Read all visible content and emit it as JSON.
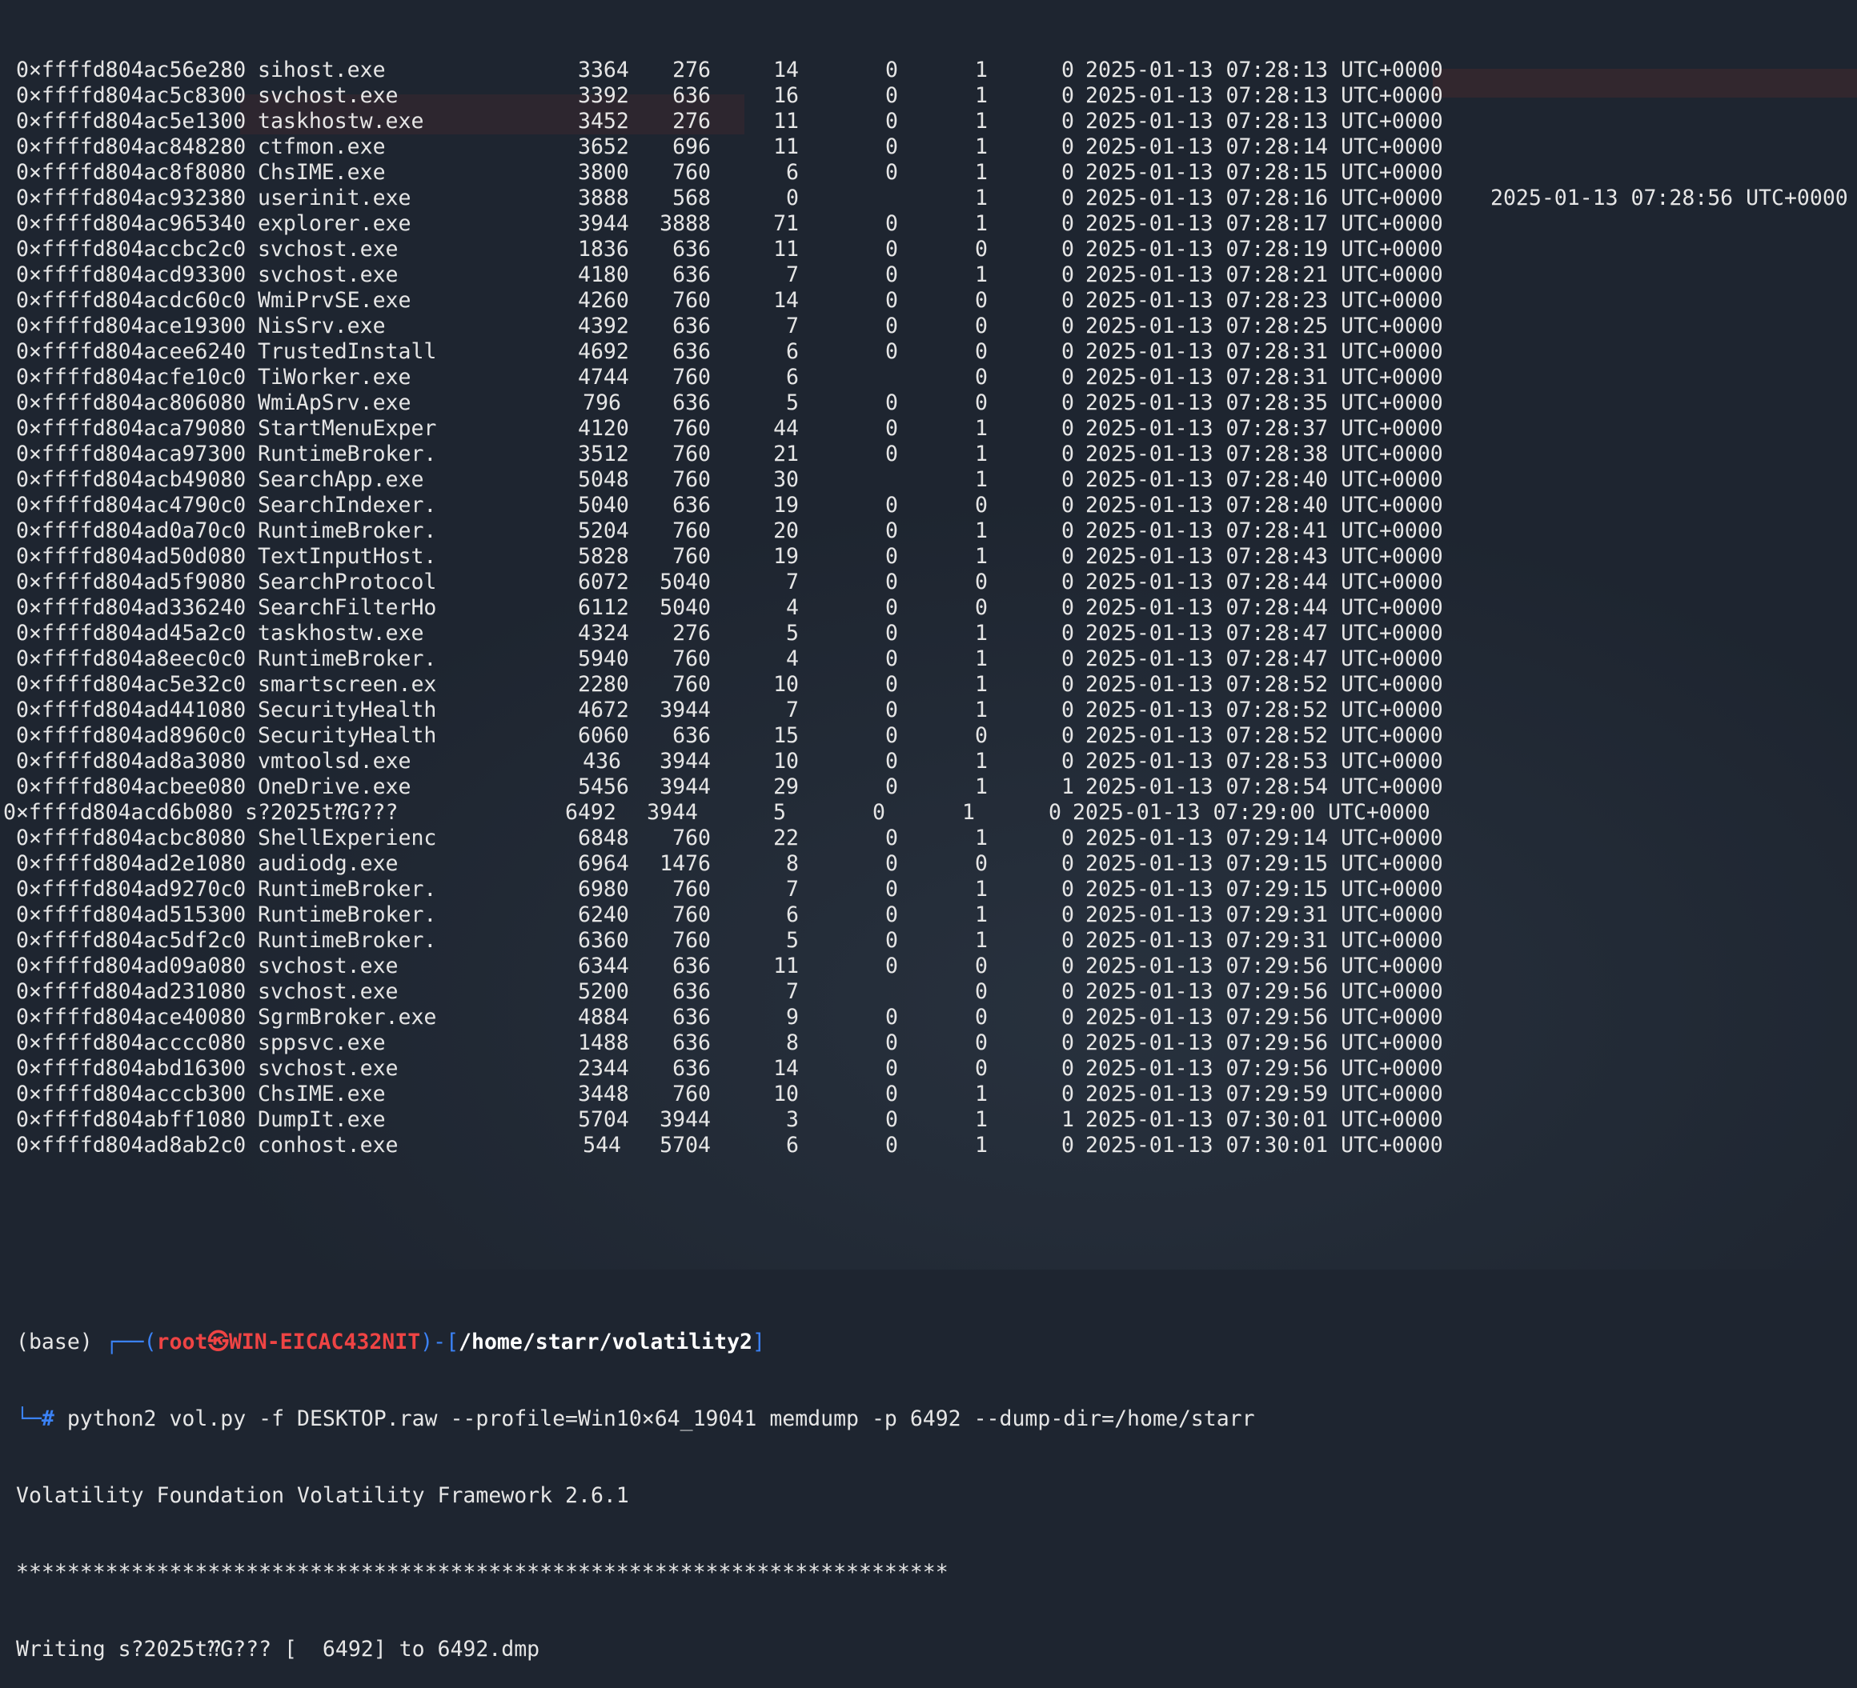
{
  "processes": [
    {
      "offset": "0×ffffd804ac56e280",
      "name": "sihost.exe",
      "pid": "3364",
      "ppid": "276",
      "thds": "14",
      "hnds": "0",
      "sess": "1",
      "wow64": "0",
      "start": "2025-01-13 07:28:13 UTC+0000",
      "exit": ""
    },
    {
      "offset": "0×ffffd804ac5c8300",
      "name": "svchost.exe",
      "pid": "3392",
      "ppid": "636",
      "thds": "16",
      "hnds": "0",
      "sess": "1",
      "wow64": "0",
      "start": "2025-01-13 07:28:13 UTC+0000",
      "exit": ""
    },
    {
      "offset": "0×ffffd804ac5e1300",
      "name": "taskhostw.exe",
      "pid": "3452",
      "ppid": "276",
      "thds": "11",
      "hnds": "0",
      "sess": "1",
      "wow64": "0",
      "start": "2025-01-13 07:28:13 UTC+0000",
      "exit": ""
    },
    {
      "offset": "0×ffffd804ac848280",
      "name": "ctfmon.exe",
      "pid": "3652",
      "ppid": "696",
      "thds": "11",
      "hnds": "0",
      "sess": "1",
      "wow64": "0",
      "start": "2025-01-13 07:28:14 UTC+0000",
      "exit": ""
    },
    {
      "offset": "0×ffffd804ac8f8080",
      "name": "ChsIME.exe",
      "pid": "3800",
      "ppid": "760",
      "thds": "6",
      "hnds": "0",
      "sess": "1",
      "wow64": "0",
      "start": "2025-01-13 07:28:15 UTC+0000",
      "exit": ""
    },
    {
      "offset": "0×ffffd804ac932380",
      "name": "userinit.exe",
      "pid": "3888",
      "ppid": "568",
      "thds": "0",
      "hnds": "",
      "sess": "1",
      "wow64": "0",
      "start": "2025-01-13 07:28:16 UTC+0000",
      "exit": "2025-01-13 07:28:56 UTC+0000"
    },
    {
      "offset": "0×ffffd804ac965340",
      "name": "explorer.exe",
      "pid": "3944",
      "ppid": "3888",
      "thds": "71",
      "hnds": "0",
      "sess": "1",
      "wow64": "0",
      "start": "2025-01-13 07:28:17 UTC+0000",
      "exit": ""
    },
    {
      "offset": "0×ffffd804accbc2c0",
      "name": "svchost.exe",
      "pid": "1836",
      "ppid": "636",
      "thds": "11",
      "hnds": "0",
      "sess": "0",
      "wow64": "0",
      "start": "2025-01-13 07:28:19 UTC+0000",
      "exit": ""
    },
    {
      "offset": "0×ffffd804acd93300",
      "name": "svchost.exe",
      "pid": "4180",
      "ppid": "636",
      "thds": "7",
      "hnds": "0",
      "sess": "1",
      "wow64": "0",
      "start": "2025-01-13 07:28:21 UTC+0000",
      "exit": ""
    },
    {
      "offset": "0×ffffd804acdc60c0",
      "name": "WmiPrvSE.exe",
      "pid": "4260",
      "ppid": "760",
      "thds": "14",
      "hnds": "0",
      "sess": "0",
      "wow64": "0",
      "start": "2025-01-13 07:28:23 UTC+0000",
      "exit": ""
    },
    {
      "offset": "0×ffffd804ace19300",
      "name": "NisSrv.exe",
      "pid": "4392",
      "ppid": "636",
      "thds": "7",
      "hnds": "0",
      "sess": "0",
      "wow64": "0",
      "start": "2025-01-13 07:28:25 UTC+0000",
      "exit": ""
    },
    {
      "offset": "0×ffffd804acee6240",
      "name": "TrustedInstall",
      "pid": "4692",
      "ppid": "636",
      "thds": "6",
      "hnds": "0",
      "sess": "0",
      "wow64": "0",
      "start": "2025-01-13 07:28:31 UTC+0000",
      "exit": ""
    },
    {
      "offset": "0×ffffd804acfe10c0",
      "name": "TiWorker.exe",
      "pid": "4744",
      "ppid": "760",
      "thds": "6",
      "hnds": "",
      "sess": "0",
      "wow64": "0",
      "start": "2025-01-13 07:28:31 UTC+0000",
      "exit": ""
    },
    {
      "offset": "0×ffffd804ac806080",
      "name": "WmiApSrv.exe",
      "pid": "796",
      "ppid": "636",
      "thds": "5",
      "hnds": "0",
      "sess": "0",
      "wow64": "0",
      "start": "2025-01-13 07:28:35 UTC+0000",
      "exit": ""
    },
    {
      "offset": "0×ffffd804aca79080",
      "name": "StartMenuExper",
      "pid": "4120",
      "ppid": "760",
      "thds": "44",
      "hnds": "0",
      "sess": "1",
      "wow64": "0",
      "start": "2025-01-13 07:28:37 UTC+0000",
      "exit": ""
    },
    {
      "offset": "0×ffffd804aca97300",
      "name": "RuntimeBroker.",
      "pid": "3512",
      "ppid": "760",
      "thds": "21",
      "hnds": "0",
      "sess": "1",
      "wow64": "0",
      "start": "2025-01-13 07:28:38 UTC+0000",
      "exit": ""
    },
    {
      "offset": "0×ffffd804acb49080",
      "name": "SearchApp.exe",
      "pid": "5048",
      "ppid": "760",
      "thds": "30",
      "hnds": "",
      "sess": "1",
      "wow64": "0",
      "start": "2025-01-13 07:28:40 UTC+0000",
      "exit": ""
    },
    {
      "offset": "0×ffffd804ac4790c0",
      "name": "SearchIndexer.",
      "pid": "5040",
      "ppid": "636",
      "thds": "19",
      "hnds": "0",
      "sess": "0",
      "wow64": "0",
      "start": "2025-01-13 07:28:40 UTC+0000",
      "exit": ""
    },
    {
      "offset": "0×ffffd804ad0a70c0",
      "name": "RuntimeBroker.",
      "pid": "5204",
      "ppid": "760",
      "thds": "20",
      "hnds": "0",
      "sess": "1",
      "wow64": "0",
      "start": "2025-01-13 07:28:41 UTC+0000",
      "exit": ""
    },
    {
      "offset": "0×ffffd804ad50d080",
      "name": "TextInputHost.",
      "pid": "5828",
      "ppid": "760",
      "thds": "19",
      "hnds": "0",
      "sess": "1",
      "wow64": "0",
      "start": "2025-01-13 07:28:43 UTC+0000",
      "exit": ""
    },
    {
      "offset": "0×ffffd804ad5f9080",
      "name": "SearchProtocol",
      "pid": "6072",
      "ppid": "5040",
      "thds": "7",
      "hnds": "0",
      "sess": "0",
      "wow64": "0",
      "start": "2025-01-13 07:28:44 UTC+0000",
      "exit": ""
    },
    {
      "offset": "0×ffffd804ad336240",
      "name": "SearchFilterHo",
      "pid": "6112",
      "ppid": "5040",
      "thds": "4",
      "hnds": "0",
      "sess": "0",
      "wow64": "0",
      "start": "2025-01-13 07:28:44 UTC+0000",
      "exit": ""
    },
    {
      "offset": "0×ffffd804ad45a2c0",
      "name": "taskhostw.exe",
      "pid": "4324",
      "ppid": "276",
      "thds": "5",
      "hnds": "0",
      "sess": "1",
      "wow64": "0",
      "start": "2025-01-13 07:28:47 UTC+0000",
      "exit": ""
    },
    {
      "offset": "0×ffffd804a8eec0c0",
      "name": "RuntimeBroker.",
      "pid": "5940",
      "ppid": "760",
      "thds": "4",
      "hnds": "0",
      "sess": "1",
      "wow64": "0",
      "start": "2025-01-13 07:28:47 UTC+0000",
      "exit": ""
    },
    {
      "offset": "0×ffffd804ac5e32c0",
      "name": "smartscreen.ex",
      "pid": "2280",
      "ppid": "760",
      "thds": "10",
      "hnds": "0",
      "sess": "1",
      "wow64": "0",
      "start": "2025-01-13 07:28:52 UTC+0000",
      "exit": ""
    },
    {
      "offset": "0×ffffd804ad441080",
      "name": "SecurityHealth",
      "pid": "4672",
      "ppid": "3944",
      "thds": "7",
      "hnds": "0",
      "sess": "1",
      "wow64": "0",
      "start": "2025-01-13 07:28:52 UTC+0000",
      "exit": ""
    },
    {
      "offset": "0×ffffd804ad8960c0",
      "name": "SecurityHealth",
      "pid": "6060",
      "ppid": "636",
      "thds": "15",
      "hnds": "0",
      "sess": "0",
      "wow64": "0",
      "start": "2025-01-13 07:28:52 UTC+0000",
      "exit": ""
    },
    {
      "offset": "0×ffffd804ad8a3080",
      "name": "vmtoolsd.exe",
      "pid": "436",
      "ppid": "3944",
      "thds": "10",
      "hnds": "0",
      "sess": "1",
      "wow64": "0",
      "start": "2025-01-13 07:28:53 UTC+0000",
      "exit": ""
    },
    {
      "offset": "0×ffffd804acbee080",
      "name": "OneDrive.exe",
      "pid": "5456",
      "ppid": "3944",
      "thds": "29",
      "hnds": "0",
      "sess": "1",
      "wow64": "1",
      "start": "2025-01-13 07:28:54 UTC+0000",
      "exit": ""
    },
    {
      "offset": "0×ffffd804acd6b080",
      "name": "s?2025t⁇G???",
      "pid": "6492",
      "ppid": "3944",
      "thds": "5",
      "hnds": "0",
      "sess": "1",
      "wow64": "0",
      "start": "2025-01-13 07:29:00 UTC+0000",
      "exit": "",
      "shift": true
    },
    {
      "offset": "0×ffffd804acbc8080",
      "name": "ShellExperienc",
      "pid": "6848",
      "ppid": "760",
      "thds": "22",
      "hnds": "0",
      "sess": "1",
      "wow64": "0",
      "start": "2025-01-13 07:29:14 UTC+0000",
      "exit": ""
    },
    {
      "offset": "0×ffffd804ad2e1080",
      "name": "audiodg.exe",
      "pid": "6964",
      "ppid": "1476",
      "thds": "8",
      "hnds": "0",
      "sess": "0",
      "wow64": "0",
      "start": "2025-01-13 07:29:15 UTC+0000",
      "exit": ""
    },
    {
      "offset": "0×ffffd804ad9270c0",
      "name": "RuntimeBroker.",
      "pid": "6980",
      "ppid": "760",
      "thds": "7",
      "hnds": "0",
      "sess": "1",
      "wow64": "0",
      "start": "2025-01-13 07:29:15 UTC+0000",
      "exit": ""
    },
    {
      "offset": "0×ffffd804ad515300",
      "name": "RuntimeBroker.",
      "pid": "6240",
      "ppid": "760",
      "thds": "6",
      "hnds": "0",
      "sess": "1",
      "wow64": "0",
      "start": "2025-01-13 07:29:31 UTC+0000",
      "exit": ""
    },
    {
      "offset": "0×ffffd804ac5df2c0",
      "name": "RuntimeBroker.",
      "pid": "6360",
      "ppid": "760",
      "thds": "5",
      "hnds": "0",
      "sess": "1",
      "wow64": "0",
      "start": "2025-01-13 07:29:31 UTC+0000",
      "exit": ""
    },
    {
      "offset": "0×ffffd804ad09a080",
      "name": "svchost.exe",
      "pid": "6344",
      "ppid": "636",
      "thds": "11",
      "hnds": "0",
      "sess": "0",
      "wow64": "0",
      "start": "2025-01-13 07:29:56 UTC+0000",
      "exit": ""
    },
    {
      "offset": "0×ffffd804ad231080",
      "name": "svchost.exe",
      "pid": "5200",
      "ppid": "636",
      "thds": "7",
      "hnds": "",
      "sess": "0",
      "wow64": "0",
      "start": "2025-01-13 07:29:56 UTC+0000",
      "exit": ""
    },
    {
      "offset": "0×ffffd804ace40080",
      "name": "SgrmBroker.exe",
      "pid": "4884",
      "ppid": "636",
      "thds": "9",
      "hnds": "0",
      "sess": "0",
      "wow64": "0",
      "start": "2025-01-13 07:29:56 UTC+0000",
      "exit": ""
    },
    {
      "offset": "0×ffffd804acccc080",
      "name": "sppsvc.exe",
      "pid": "1488",
      "ppid": "636",
      "thds": "8",
      "hnds": "0",
      "sess": "0",
      "wow64": "0",
      "start": "2025-01-13 07:29:56 UTC+0000",
      "exit": ""
    },
    {
      "offset": "0×ffffd804abd16300",
      "name": "svchost.exe",
      "pid": "2344",
      "ppid": "636",
      "thds": "14",
      "hnds": "0",
      "sess": "0",
      "wow64": "0",
      "start": "2025-01-13 07:29:56 UTC+0000",
      "exit": ""
    },
    {
      "offset": "0×ffffd804acccb300",
      "name": "ChsIME.exe",
      "pid": "3448",
      "ppid": "760",
      "thds": "10",
      "hnds": "0",
      "sess": "1",
      "wow64": "0",
      "start": "2025-01-13 07:29:59 UTC+0000",
      "exit": ""
    },
    {
      "offset": "0×ffffd804abff1080",
      "name": "DumpIt.exe",
      "pid": "5704",
      "ppid": "3944",
      "thds": "3",
      "hnds": "0",
      "sess": "1",
      "wow64": "1",
      "start": "2025-01-13 07:30:01 UTC+0000",
      "exit": ""
    },
    {
      "offset": "0×ffffd804ad8ab2c0",
      "name": "conhost.exe",
      "pid": "544",
      "ppid": "5704",
      "thds": "6",
      "hnds": "0",
      "sess": "1",
      "wow64": "0",
      "start": "2025-01-13 07:30:01 UTC+0000",
      "exit": ""
    }
  ],
  "prompt": {
    "env": "(base)",
    "corner": "┌──(",
    "user_host": "root㉿WIN-EICAC432NIT",
    "mid": ")-[",
    "path": "/home/starr/volatility2",
    "end": "]",
    "hash_prefix": "└─#",
    "command": " python2 vol.py -f DESKTOP.raw --profile=Win10×64_19041 memdump -p 6492 --dump-dir=/home/starr"
  },
  "output": {
    "banner": "Volatility Foundation Volatility Framework 2.6.1",
    "stars": "*************************************************************************",
    "writing": "Writing s?2025t⁇G??? [  6492] to 6492.dmp"
  }
}
